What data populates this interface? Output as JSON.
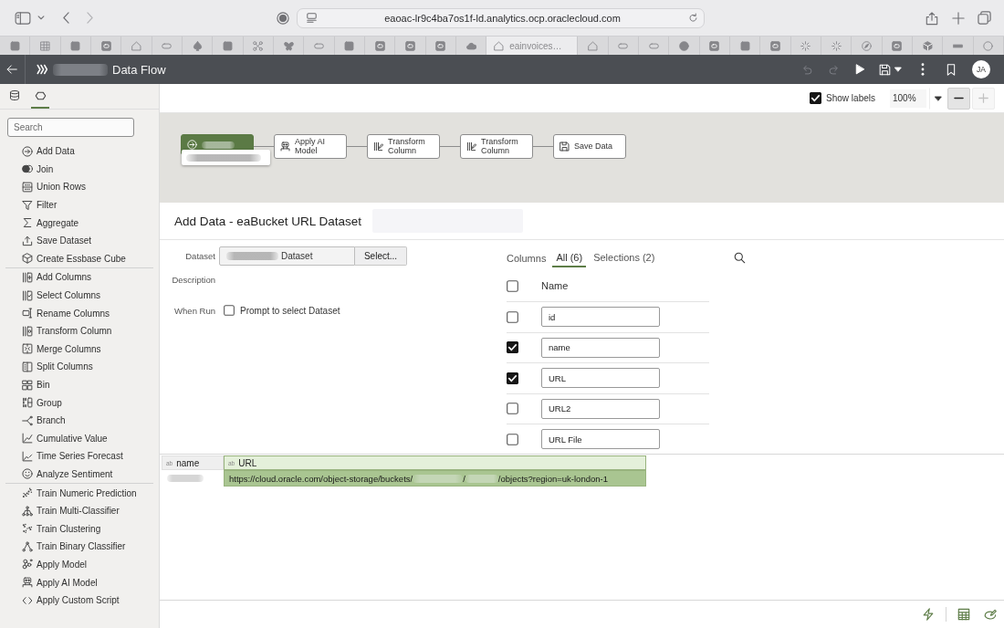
{
  "browser": {
    "address": "eaoac-lr9c4ba7os1f-ld.analytics.ocp.oraclecloud.com",
    "tabs": [
      {
        "selected": false
      },
      {
        "selected": false
      },
      {
        "selected": false
      },
      {
        "selected": false
      },
      {
        "selected": false
      },
      {
        "selected": false
      },
      {
        "selected": false
      },
      {
        "selected": false
      },
      {
        "selected": false
      },
      {
        "selected": false
      },
      {
        "selected": false
      },
      {
        "selected": false
      },
      {
        "selected": false
      },
      {
        "selected": false
      },
      {
        "selected": false
      },
      {
        "selected": false
      },
      {
        "title": "eainvoices…",
        "selected": true
      },
      {
        "selected": false
      },
      {
        "selected": false
      },
      {
        "selected": false
      },
      {
        "selected": false
      },
      {
        "selected": false
      },
      {
        "selected": false
      },
      {
        "selected": false
      },
      {
        "selected": false
      },
      {
        "selected": false
      },
      {
        "selected": false
      },
      {
        "selected": false
      },
      {
        "selected": false
      },
      {
        "selected": false
      },
      {
        "selected": false
      }
    ]
  },
  "app_bar": {
    "title": "Data Flow",
    "undo": {
      "disabled": true
    },
    "redo": {
      "disabled": true
    },
    "avatar": "JA"
  },
  "side_panel": {
    "tabs": [
      {
        "selected": false
      },
      {
        "selected": true
      }
    ],
    "search": {
      "placeholder": "Search"
    },
    "step_groups": [
      {
        "steps": [
          {
            "label": "Add Data"
          },
          {
            "label": "Join"
          },
          {
            "label": "Union Rows"
          },
          {
            "label": "Filter"
          },
          {
            "label": "Aggregate"
          },
          {
            "label": "Save Dataset"
          },
          {
            "label": "Create Essbase Cube"
          }
        ]
      },
      {
        "steps": [
          {
            "label": "Add Columns"
          },
          {
            "label": "Select Columns"
          },
          {
            "label": "Rename Columns"
          },
          {
            "label": "Transform Column"
          },
          {
            "label": "Merge Columns"
          },
          {
            "label": "Split Columns"
          },
          {
            "label": "Bin"
          },
          {
            "label": "Group"
          },
          {
            "label": "Branch"
          },
          {
            "label": "Cumulative Value"
          },
          {
            "label": "Time Series Forecast"
          },
          {
            "label": "Analyze Sentiment"
          }
        ]
      },
      {
        "steps": [
          {
            "label": "Train Numeric Prediction"
          },
          {
            "label": "Train Multi-Classifier"
          },
          {
            "label": "Train Clustering"
          },
          {
            "label": "Train Binary Classifier"
          },
          {
            "label": "Apply Model"
          },
          {
            "label": "Apply AI Model"
          },
          {
            "label": "Apply Custom Script"
          }
        ]
      }
    ]
  },
  "canvas_toolbar": {
    "show_labels": {
      "label": "Show labels",
      "checked": true
    },
    "zoom": "100%",
    "zoom_out": {
      "disabled": false
    },
    "zoom_in": {
      "disabled": true
    }
  },
  "flow": {
    "nodes": [
      {
        "kind": "add_data",
        "selected": true
      },
      {
        "kind": "apply_ai_model",
        "label": "Apply AI Model",
        "selected": false
      },
      {
        "kind": "transform_column",
        "label": "Transform Column",
        "selected": false
      },
      {
        "kind": "transform_column",
        "label": "Transform Column",
        "selected": false
      },
      {
        "kind": "save_data",
        "label": "Save Data",
        "selected": false
      }
    ]
  },
  "step_editor": {
    "title": "Add Data - eaBucket URL Dataset",
    "dataset": {
      "label": "Dataset",
      "value": "Dataset",
      "button": "Select..."
    },
    "description": {
      "label": "Description"
    },
    "when_run": {
      "label": "When Run",
      "option": "Prompt to select Dataset",
      "checked": false
    },
    "columns": {
      "label": "Columns",
      "tabs": [
        {
          "label": "All (6)",
          "selected": true
        },
        {
          "label": "Selections (2)",
          "selected": false
        }
      ],
      "header": {
        "label": "Name",
        "checked": false
      },
      "rows": [
        {
          "name": "id",
          "checked": false
        },
        {
          "name": "name",
          "checked": true
        },
        {
          "name": "URL",
          "checked": true
        },
        {
          "name": "URL2",
          "checked": false
        },
        {
          "name": "URL File",
          "checked": false
        }
      ]
    }
  },
  "preview": {
    "columns": [
      {
        "type": "ab",
        "name": "name",
        "selected": false
      },
      {
        "type": "ab",
        "name": "URL",
        "selected": true
      }
    ],
    "rows": [
      {
        "url_segments": [
          "https://cloud.oracle.com/object-storage/buckets/",
          "/",
          "/objects?region=uk-london-1"
        ]
      }
    ]
  }
}
